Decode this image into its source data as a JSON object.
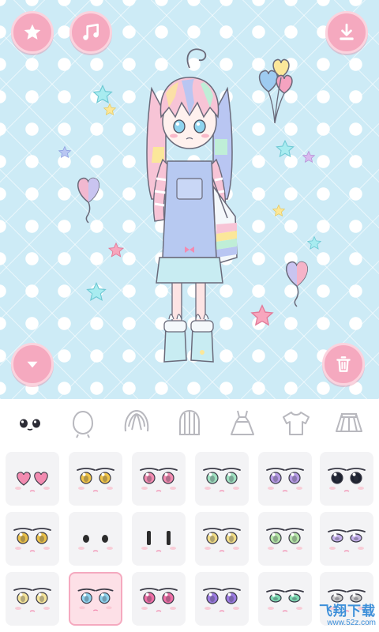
{
  "colors": {
    "background": "#cdebf6",
    "button_pink": "#f5a9bf",
    "cell_bg": "#f3f3f5",
    "cell_selected": "#fde0e7",
    "icon_outline": "#b8b8be"
  },
  "toolbar": {
    "top_left": [
      {
        "icon": "star-icon"
      },
      {
        "icon": "music-note-icon"
      }
    ],
    "top_right": {
      "icon": "download-icon"
    },
    "bottom_left": {
      "icon": "chevron-down-icon"
    },
    "bottom_right": {
      "icon": "trash-icon"
    }
  },
  "categories": [
    {
      "id": "eyes",
      "icon": "eyes-face-icon",
      "active": true
    },
    {
      "id": "head",
      "icon": "head-shape-icon",
      "active": false
    },
    {
      "id": "bangs",
      "icon": "bangs-hair-icon",
      "active": false
    },
    {
      "id": "back-hair",
      "icon": "back-hair-icon",
      "active": false
    },
    {
      "id": "dress",
      "icon": "dress-icon",
      "active": false
    },
    {
      "id": "shirt",
      "icon": "shirt-icon",
      "active": false
    },
    {
      "id": "skirt",
      "icon": "skirt-icon",
      "active": false
    }
  ],
  "eye_options": [
    {
      "name": "heart-eyes",
      "iris": "#f28bb0",
      "selected": false
    },
    {
      "name": "yellow-eyes",
      "iris": "#f2c64a",
      "selected": false
    },
    {
      "name": "pink-eyes",
      "iris": "#f28bb0",
      "selected": false
    },
    {
      "name": "green-eyes",
      "iris": "#9fe0c0",
      "selected": false
    },
    {
      "name": "purple-eyes",
      "iris": "#b79be6",
      "selected": false
    },
    {
      "name": "teal-sparkle-eyes",
      "iris": "#1d2230",
      "selected": false
    },
    {
      "name": "gold-sparkle-eyes",
      "iris": "#e9c04a",
      "selected": false
    },
    {
      "name": "dot-eyes",
      "iris": "#2b2b2b",
      "selected": false
    },
    {
      "name": "bar-eyes",
      "iris": "#2b2b2b",
      "selected": false
    },
    {
      "name": "yellow-round-eyes",
      "iris": "#f0dc86",
      "selected": false
    },
    {
      "name": "green-round-eyes",
      "iris": "#b6e6a8",
      "selected": false
    },
    {
      "name": "lavender-sleepy-eyes",
      "iris": "#c4b0ea",
      "selected": false
    },
    {
      "name": "yellow-pale-eyes",
      "iris": "#f4e49a",
      "selected": false
    },
    {
      "name": "blue-eyes",
      "iris": "#8fd3ee",
      "selected": true
    },
    {
      "name": "magenta-eyes",
      "iris": "#ee6fa6",
      "selected": false
    },
    {
      "name": "violet-eyes",
      "iris": "#9b7be0",
      "selected": false
    },
    {
      "name": "mint-eyes",
      "iris": "#7fd9b3",
      "selected": false
    },
    {
      "name": "gray-eyes",
      "iris": "#c9c9c9",
      "selected": false
    }
  ],
  "watermark": {
    "title": "飞翔下载",
    "url": "www.52z.com"
  }
}
